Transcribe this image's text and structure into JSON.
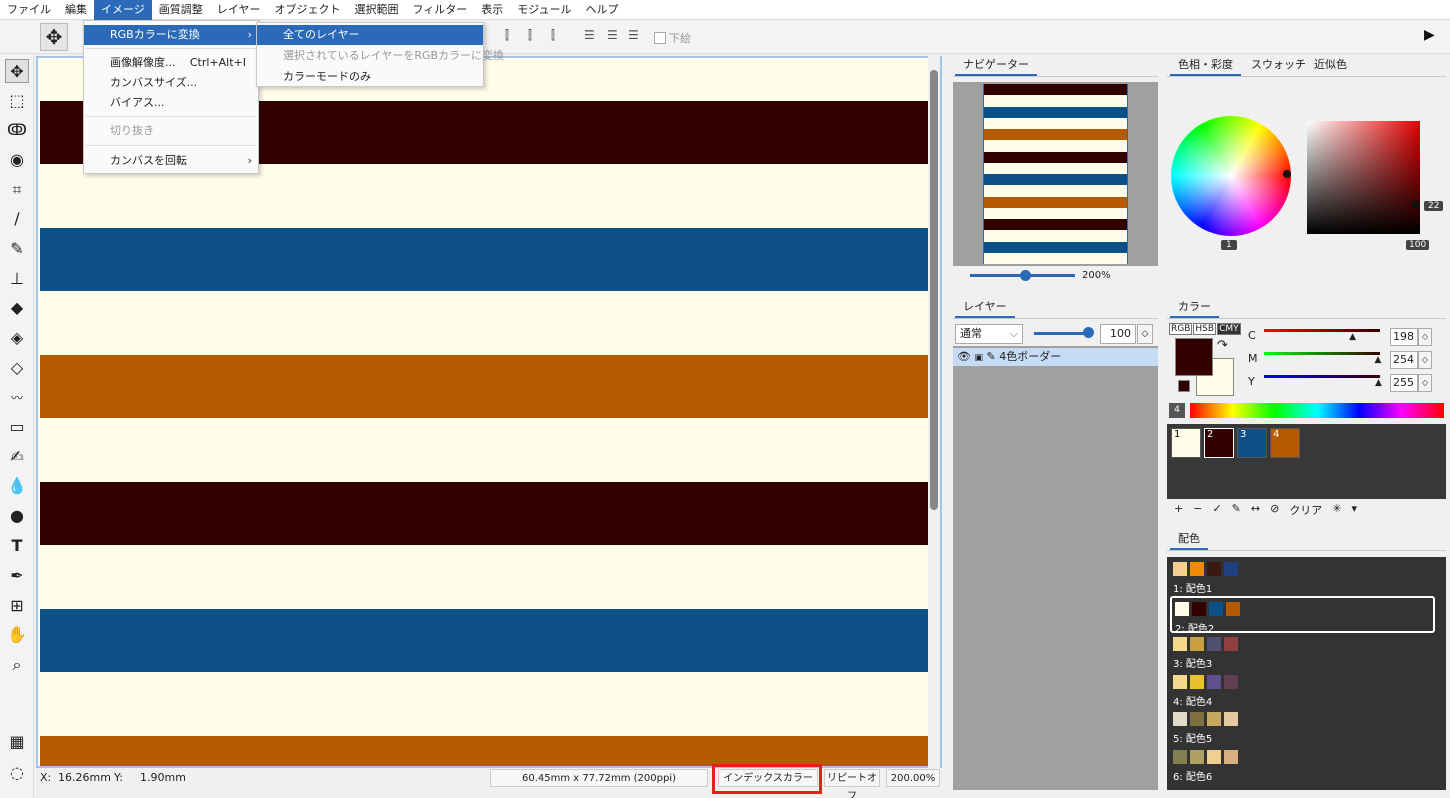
{
  "menubar": [
    "ファイル",
    "編集",
    "イメージ",
    "画質調整",
    "レイヤー",
    "オブジェクト",
    "選択範囲",
    "フィルター",
    "表示",
    "モジュール",
    "ヘルプ"
  ],
  "toolbar": {
    "underdraw_label": "下絵"
  },
  "image_menu": {
    "items": [
      {
        "label": "RGBカラーに変換",
        "shortcut": "",
        "submenu": true,
        "highlight": true,
        "disabled": false
      },
      {
        "label": "画像解像度...",
        "shortcut": "Ctrl+Alt+I",
        "submenu": false,
        "highlight": false,
        "disabled": false
      },
      {
        "label": "カンバスサイズ...",
        "shortcut": "",
        "submenu": false,
        "highlight": false,
        "disabled": false
      },
      {
        "label": "バイアス...",
        "shortcut": "",
        "submenu": false,
        "highlight": false,
        "disabled": false
      },
      {
        "label": "切り抜き",
        "shortcut": "",
        "submenu": false,
        "highlight": false,
        "disabled": true
      },
      {
        "label": "カンバスを回転",
        "shortcut": "",
        "submenu": true,
        "highlight": false,
        "disabled": false
      }
    ]
  },
  "rgb_submenu": {
    "items": [
      {
        "label": "全てのレイヤー",
        "highlight": true,
        "disabled": false
      },
      {
        "label": "選択されているレイヤーをRGBカラーに変換",
        "highlight": false,
        "disabled": true
      },
      {
        "label": "カラーモードのみ",
        "highlight": false,
        "disabled": false
      }
    ]
  },
  "canvas": {
    "stripe_colors": [
      "#fffde8",
      "#330000",
      "#fffde8",
      "#0d4f87",
      "#fffde8",
      "#b55a00",
      "#fffde8",
      "#330000",
      "#fffde8",
      "#0d4f87",
      "#fffde8",
      "#b55a00"
    ]
  },
  "status": {
    "x_label": "X:",
    "x_value": "16.26mm",
    "y_label": "Y:",
    "y_value": "1.90mm",
    "doc_size": "60.45mm x 77.72mm (200ppi)",
    "index_color_button": "インデックスカラー",
    "repeat_button": "リピートオフ",
    "zoom": "200.00%"
  },
  "navigator": {
    "tab": "ナビゲーター",
    "zoom": "200%"
  },
  "layers": {
    "tab": "レイヤー",
    "blend_mode": "通常",
    "opacity": "100",
    "layer_name": "4色ボーダー"
  },
  "color_panel": {
    "tabs": [
      "色相・彩度",
      "スウォッチ",
      "近似色"
    ],
    "hue_value": "1",
    "sat_value": "22",
    "bri_value": "100"
  },
  "color": {
    "tab": "カラー",
    "modes": [
      "RGB",
      "HSB",
      "CMY"
    ],
    "front_color": "#330000",
    "back_color": "#fffde8",
    "sliders": [
      {
        "label": "C",
        "value": "198"
      },
      {
        "label": "M",
        "value": "254"
      },
      {
        "label": "Y",
        "value": "255"
      }
    ],
    "palette_count": "4",
    "swatches": [
      {
        "num": "1",
        "color": "#fffde8"
      },
      {
        "num": "2",
        "color": "#330000"
      },
      {
        "num": "3",
        "color": "#0d4f87"
      },
      {
        "num": "4",
        "color": "#b55a00"
      }
    ],
    "palette_toolbar": [
      "+",
      "−",
      "✓",
      "✎",
      "↔",
      "⊘",
      "クリア",
      "✳",
      "▾"
    ]
  },
  "schemes": {
    "tab": "配色",
    "items": [
      {
        "label": "1: 配色1",
        "colors": [
          "#f5cf90",
          "#f08a00",
          "#3a1a10",
          "#1e3f80"
        ],
        "selected": false
      },
      {
        "label": "2: 配色2",
        "colors": [
          "#fffde8",
          "#330000",
          "#0d4f87",
          "#b55a00"
        ],
        "selected": true
      },
      {
        "label": "3: 配色3",
        "colors": [
          "#f5d88a",
          "#c8a040",
          "#505070",
          "#904040"
        ],
        "selected": false
      },
      {
        "label": "4: 配色4",
        "colors": [
          "#f5d890",
          "#e8c030",
          "#605090",
          "#604050"
        ],
        "selected": false
      },
      {
        "label": "5: 配色5",
        "colors": [
          "#e0dcc8",
          "#807040",
          "#c8a860",
          "#e8c8a0"
        ],
        "selected": false
      },
      {
        "label": "6: 配色6",
        "colors": [
          "#808050",
          "#b0a060",
          "#f0d090",
          "#d8b080"
        ],
        "selected": false
      }
    ]
  }
}
